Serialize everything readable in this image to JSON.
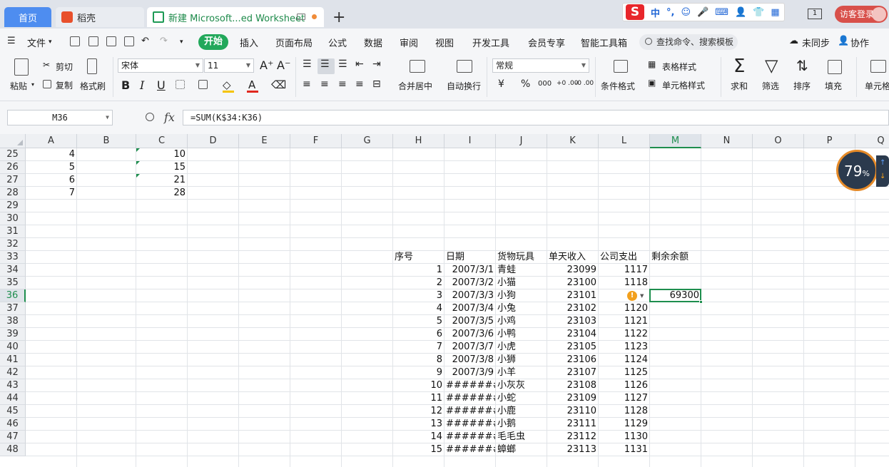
{
  "tabs": {
    "home": "首页",
    "daoke": "稻壳",
    "doc": "新建 Microsoft...ed Worksheet",
    "add": "+"
  },
  "ime": {
    "logo": "S",
    "items": [
      "中",
      "°,",
      "☺",
      "🎤",
      "⌨",
      "👤",
      "👕",
      "▦"
    ]
  },
  "window": {
    "badge": "1",
    "login": "访客登录"
  },
  "menu": {
    "file": "文件",
    "items": [
      "开始",
      "插入",
      "页面布局",
      "公式",
      "数据",
      "审阅",
      "视图",
      "开发工具",
      "会员专享",
      "智能工具箱"
    ],
    "search": "查找命令、搜索模板",
    "sync": "未同步",
    "collab": "协作"
  },
  "ribbon": {
    "paste": "粘贴",
    "cut": "剪切",
    "copy": "复制",
    "format_painter": "格式刷",
    "font_name": "宋体",
    "font_size": "11",
    "bold": "B",
    "italic": "I",
    "underline": "U",
    "font_color": "A",
    "merge_center": "合并居中",
    "wrap_text": "自动换行",
    "number_format": "常规",
    "currency": "¥",
    "percent": "%",
    "thousands": "000",
    "dec_inc": "+0 .00",
    "dec_dec": "-0 .00",
    "table_style": "表格样式",
    "cond_format": "条件格式",
    "cell_style": "单元格样式",
    "sum": "求和",
    "filter": "筛选",
    "sort": "排序",
    "fill": "填充",
    "cell": "单元格"
  },
  "formula_bar": {
    "name_box": "M36",
    "fx": "fx",
    "formula": "=SUM(K$34:K36)"
  },
  "columns": [
    "A",
    "B",
    "C",
    "D",
    "E",
    "F",
    "G",
    "H",
    "I",
    "J",
    "K",
    "L",
    "M",
    "N",
    "O",
    "P",
    "Q"
  ],
  "active_column": "M",
  "rows": [
    25,
    26,
    27,
    28,
    29,
    30,
    31,
    32,
    33,
    34,
    35,
    36,
    37,
    38,
    39,
    40,
    41,
    42,
    43,
    44,
    45,
    46,
    47,
    48
  ],
  "active_row": 36,
  "left_block": [
    {
      "row": 25,
      "A": "4",
      "C": "10"
    },
    {
      "row": 26,
      "A": "5",
      "C": "15"
    },
    {
      "row": 27,
      "A": "6",
      "C": "21"
    },
    {
      "row": 28,
      "A": "7",
      "C": "28"
    }
  ],
  "table": {
    "header_row": 33,
    "headers": [
      "序号",
      "日期",
      "货物玩具",
      "单天收入",
      "公司支出",
      "剩余余额"
    ],
    "rows": [
      {
        "no": "1",
        "date": "2007/3/1",
        "item": "青蛙",
        "income": "23099",
        "expense": "1117",
        "balance": ""
      },
      {
        "no": "2",
        "date": "2007/3/2",
        "item": "小猫",
        "income": "23100",
        "expense": "1118",
        "balance": ""
      },
      {
        "no": "3",
        "date": "2007/3/3",
        "item": "小狗",
        "income": "23101",
        "expense": "",
        "balance": "69300"
      },
      {
        "no": "4",
        "date": "2007/3/4",
        "item": "小兔",
        "income": "23102",
        "expense": "1120",
        "balance": ""
      },
      {
        "no": "5",
        "date": "2007/3/5",
        "item": "小鸡",
        "income": "23103",
        "expense": "1121",
        "balance": ""
      },
      {
        "no": "6",
        "date": "2007/3/6",
        "item": "小鸭",
        "income": "23104",
        "expense": "1122",
        "balance": ""
      },
      {
        "no": "7",
        "date": "2007/3/7",
        "item": "小虎",
        "income": "23105",
        "expense": "1123",
        "balance": ""
      },
      {
        "no": "8",
        "date": "2007/3/8",
        "item": "小狮",
        "income": "23106",
        "expense": "1124",
        "balance": ""
      },
      {
        "no": "9",
        "date": "2007/3/9",
        "item": "小羊",
        "income": "23107",
        "expense": "1125",
        "balance": ""
      },
      {
        "no": "10",
        "date": "########",
        "item": "小灰灰",
        "income": "23108",
        "expense": "1126",
        "balance": ""
      },
      {
        "no": "11",
        "date": "########",
        "item": "小蛇",
        "income": "23109",
        "expense": "1127",
        "balance": ""
      },
      {
        "no": "12",
        "date": "########",
        "item": "小鹿",
        "income": "23110",
        "expense": "1128",
        "balance": ""
      },
      {
        "no": "13",
        "date": "########",
        "item": "小鹅",
        "income": "23111",
        "expense": "1129",
        "balance": ""
      },
      {
        "no": "14",
        "date": "########",
        "item": "毛毛虫",
        "income": "23112",
        "expense": "1130",
        "balance": ""
      },
      {
        "no": "15",
        "date": "########",
        "item": "蟑螂",
        "income": "23113",
        "expense": "1131",
        "balance": ""
      }
    ]
  },
  "warning": "!",
  "speed_widget": {
    "value": "79",
    "unit": "%"
  },
  "colors": {
    "accent": "#1e8e4e",
    "home_tab": "#4e8df0",
    "start_menu": "#22a85b",
    "login": "#d8504a"
  }
}
